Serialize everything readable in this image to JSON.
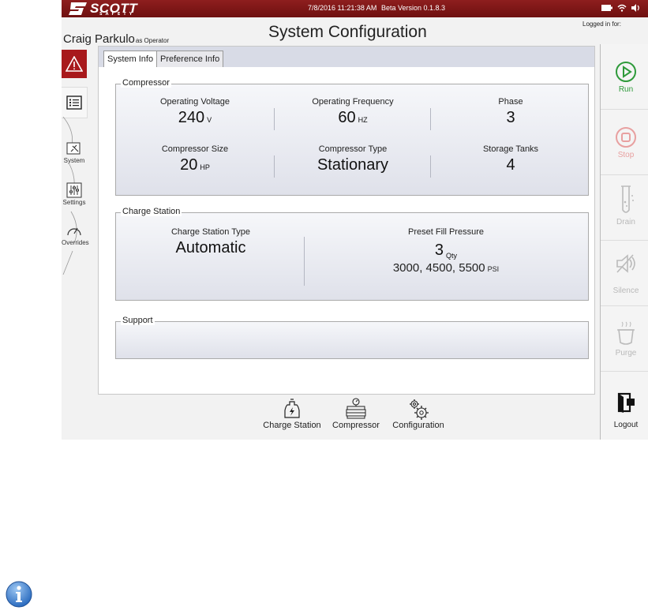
{
  "topbar": {
    "brand": "SCOTT",
    "brand_sub": "SAFETY",
    "datetime": "7/8/2016 11:21:38 AM",
    "version": "Beta Version 0.1.8.3",
    "status_icons": [
      "battery-icon",
      "wifi-icon",
      "speaker-icon"
    ]
  },
  "header": {
    "user_name": "Craig Parkulo",
    "user_role": "as Operator",
    "page_title": "System Configuration",
    "logged_in_label": "Logged in for:"
  },
  "left_nav": {
    "alert_icon": "warning-icon",
    "list_icon": "list-icon",
    "items": [
      {
        "label": "System",
        "icon": "system-icon"
      },
      {
        "label": "Settings",
        "icon": "settings-sliders-icon"
      },
      {
        "label": "Overrides",
        "icon": "gauge-icon"
      }
    ]
  },
  "tabs": [
    {
      "label": "System Info",
      "active": true
    },
    {
      "label": "Preference Info",
      "active": false
    }
  ],
  "compressor": {
    "title": "Compressor",
    "operating_voltage": {
      "label": "Operating Voltage",
      "value": "240",
      "unit": "V"
    },
    "operating_frequency": {
      "label": "Operating Frequency",
      "value": "60",
      "unit": "HZ"
    },
    "phase": {
      "label": "Phase",
      "value": "3"
    },
    "compressor_size": {
      "label": "Compressor Size",
      "value": "20",
      "unit": "HP"
    },
    "compressor_type": {
      "label": "Compressor Type",
      "value": "Stationary"
    },
    "storage_tanks": {
      "label": "Storage Tanks",
      "value": "4"
    }
  },
  "charge_station": {
    "title": "Charge Station",
    "type_label": "Charge Station Type",
    "type_value": "Automatic",
    "preset_label": "Preset Fill Pressure",
    "preset_qty": "3",
    "preset_qty_unit": "Qty",
    "preset_values": "3000, 4500, 5500",
    "preset_unit": "PSI"
  },
  "support": {
    "title": "Support"
  },
  "right_nav": [
    {
      "label": "Run",
      "icon": "play-icon",
      "enabled": true,
      "color": "#2e9a3a"
    },
    {
      "label": "Stop",
      "icon": "stop-icon",
      "enabled": false,
      "color": "#e8a0a0"
    },
    {
      "label": "Drain",
      "icon": "test-tube-icon",
      "enabled": false
    },
    {
      "label": "Silence",
      "icon": "speaker-mute-icon",
      "enabled": false
    },
    {
      "label": "Purge",
      "icon": "pot-icon",
      "enabled": false
    },
    {
      "label": "Logout",
      "icon": "logout-icon",
      "enabled": true
    }
  ],
  "bottom_nav": [
    {
      "label": "Charge Station",
      "icon": "charge-station-icon"
    },
    {
      "label": "Compressor",
      "icon": "compressor-icon"
    },
    {
      "label": "Configuration",
      "icon": "gears-icon"
    }
  ],
  "colors": {
    "brand_red": "#8e1e1e",
    "alert_red": "#a8191c",
    "run_green": "#2e9a3a",
    "info_blue": "#3b7fd0"
  }
}
